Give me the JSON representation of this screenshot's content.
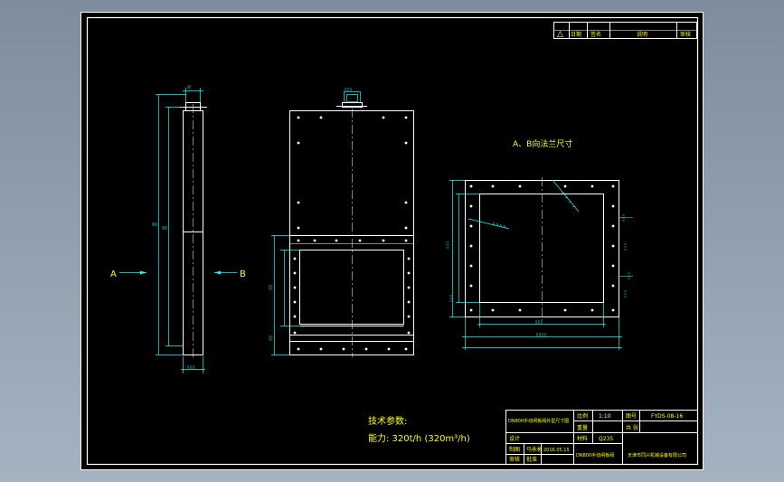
{
  "colors": {
    "viewport_bg": "#8a9bab",
    "paper": "#000000",
    "border": "#ffffff",
    "dimension": "#00ffff",
    "centerline": "#ffffff",
    "text_yellow": "#ffff00",
    "bolt": "#ffffff",
    "title_lines": "#ffffff"
  },
  "revision_table": {
    "symbol": "△",
    "date": "日期",
    "sign": "签名",
    "content": "说明",
    "approve": "审核"
  },
  "views": {
    "section_a_label": "A",
    "section_b_label": "B",
    "flange_title": "A、B向法兰尺寸"
  },
  "notes": {
    "title": "技术参数:",
    "capacity": "能力: 320t/h  (320m³/h)"
  },
  "title_block": {
    "product_name": "DN800手动闸板阀外型尺寸图",
    "scale_label": "比例",
    "scale_value": "1:10",
    "drawing_no_label": "图号",
    "drawing_no_value": "FYDS-08-16",
    "weight_label": "重量",
    "sheet_label": "共 张",
    "material_label": "材料",
    "material_value": "Q235",
    "designed_label": "设计",
    "drawn_label": "制图",
    "drawn_by": "马永彬",
    "date_value": "2016.05.15",
    "checked_label": "审核",
    "approved_label": "批准",
    "part_name": "DN800手动闸板阀",
    "company": "天津市同兴机械设备有限公司"
  }
}
